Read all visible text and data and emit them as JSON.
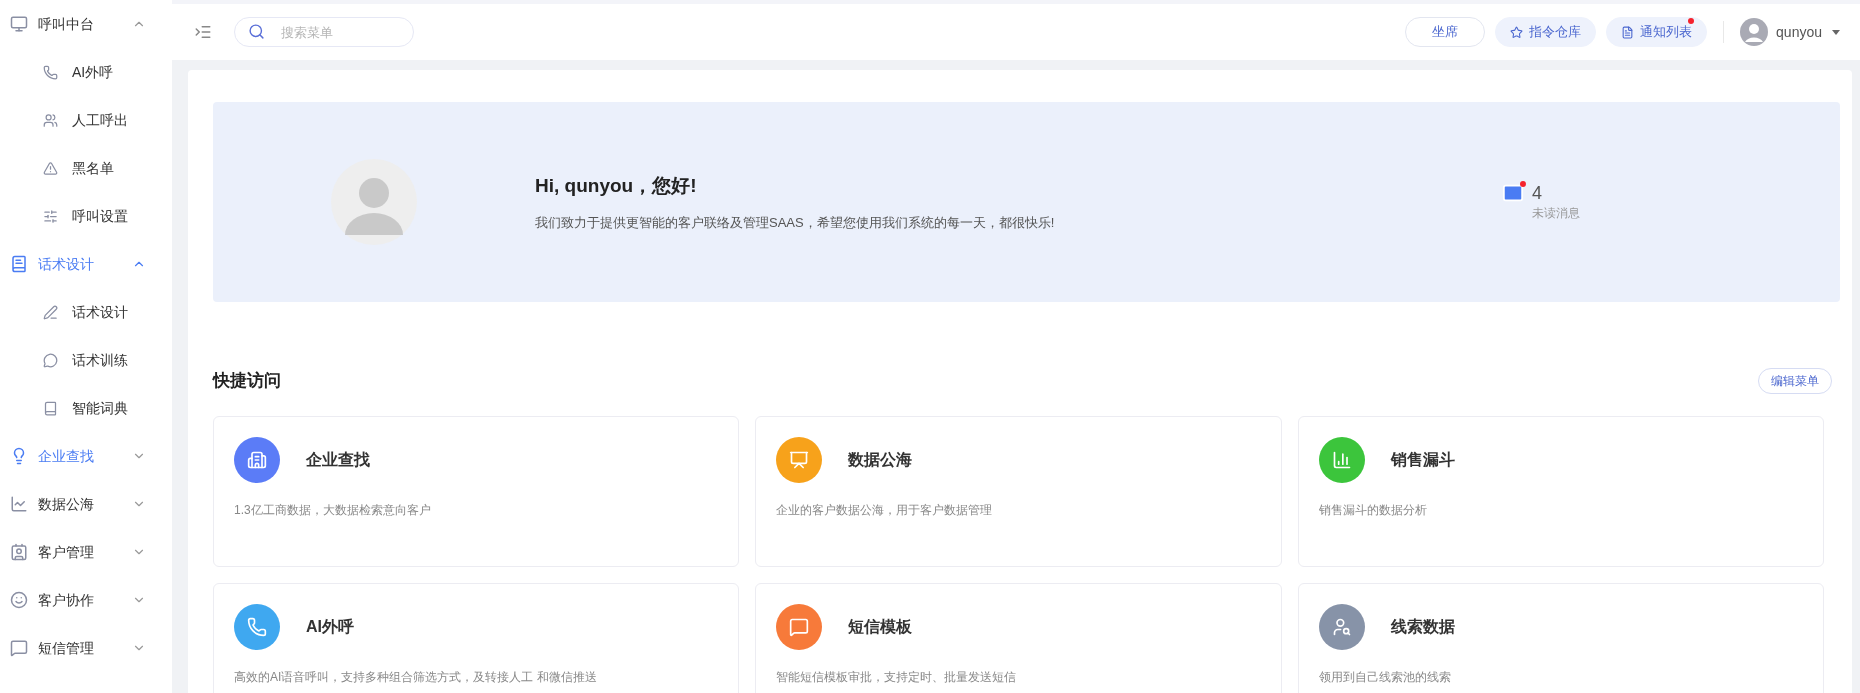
{
  "sidebar": {
    "groups": [
      {
        "label": "呼叫中台",
        "active": false,
        "expanded": true,
        "children": [
          {
            "label": "AI外呼",
            "selected": false
          },
          {
            "label": "人工呼出",
            "selected": false
          },
          {
            "label": "黑名单",
            "selected": false
          },
          {
            "label": "呼叫设置",
            "selected": false
          }
        ]
      },
      {
        "label": "话术设计",
        "active": true,
        "expanded": true,
        "children": [
          {
            "label": "话术设计",
            "selected": false
          },
          {
            "label": "话术训练",
            "selected": false
          },
          {
            "label": "智能词典",
            "selected": false
          }
        ]
      },
      {
        "label": "企业查找",
        "active": true,
        "expanded": false
      },
      {
        "label": "数据公海",
        "active": false,
        "expanded": false
      },
      {
        "label": "客户管理",
        "active": false,
        "expanded": false
      },
      {
        "label": "客户协作",
        "active": false,
        "expanded": false
      },
      {
        "label": "短信管理",
        "active": false,
        "expanded": false
      }
    ]
  },
  "topbar": {
    "search": {
      "placeholder": "搜索菜单"
    },
    "buttons": [
      {
        "label": "坐席",
        "kind": "outline",
        "badge": false
      },
      {
        "label": "指令仓库",
        "kind": "filled",
        "badge": false
      },
      {
        "label": "通知列表",
        "kind": "filled",
        "badge": true
      }
    ],
    "user": {
      "name": "qunyou"
    }
  },
  "banner": {
    "greeting": "Hi, qunyou，您好!",
    "message": "我们致力于提供更智能的客户联络及管理SAAS，希望您使用我们系统的每一天，都很快乐!",
    "unread": {
      "count": "4",
      "label": "未读消息",
      "dot": true
    }
  },
  "quick_access": {
    "title": "快捷访问",
    "edit_button": "编辑菜单",
    "cards": [
      {
        "title": "企业查找",
        "description": "1.3亿工商数据，大数据检索意向客户",
        "color": "#5b7cf7"
      },
      {
        "title": "数据公海",
        "description": "企业的客户数据公海，用于客户数据管理",
        "color": "#f7a21b"
      },
      {
        "title": "销售漏斗",
        "description": "销售漏斗的数据分析",
        "color": "#3cc53c"
      },
      {
        "title": "AI外呼",
        "description": "高效的AI语音呼叫，支持多种组合筛选方式，及转接人工 和微信推送",
        "color": "#3fa8f0"
      },
      {
        "title": "短信模板",
        "description": "智能短信模板审批，支持定时、批量发送短信",
        "color": "#f77a3a"
      },
      {
        "title": "线索数据",
        "description": "领用到自己线索池的线索",
        "color": "#8793a8"
      }
    ]
  }
}
